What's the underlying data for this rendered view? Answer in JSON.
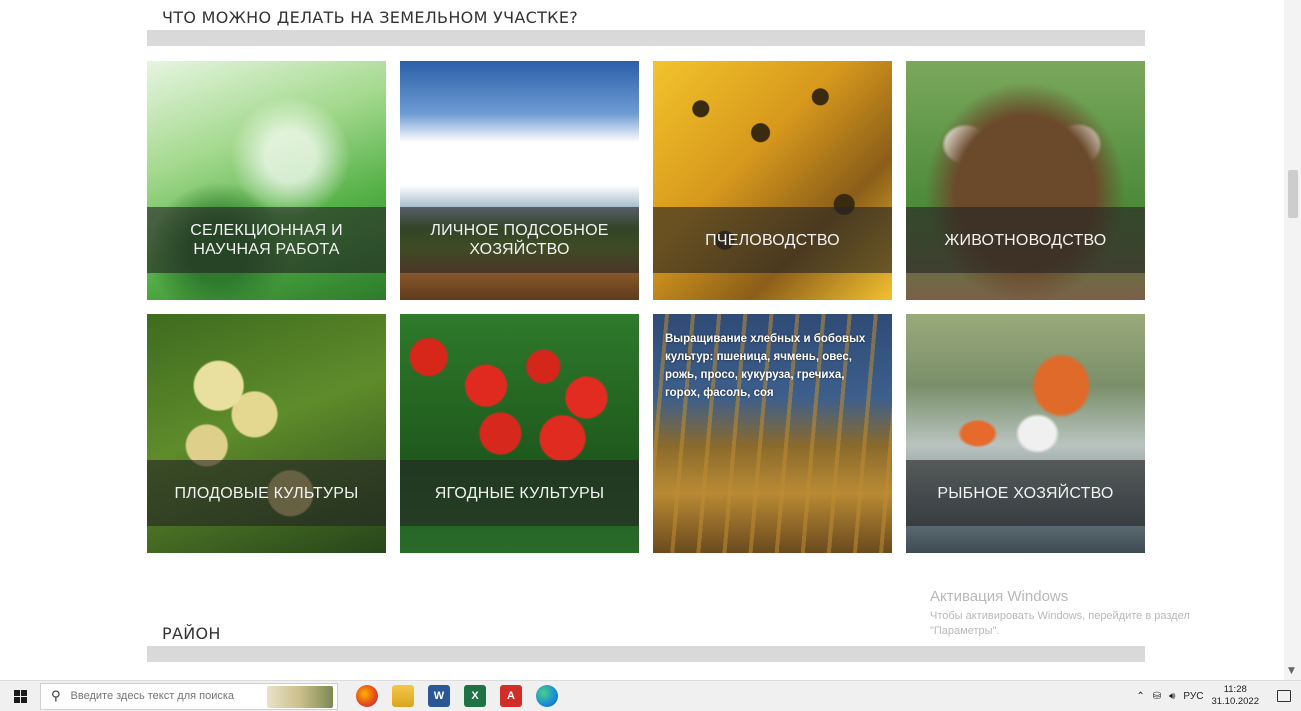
{
  "section1": {
    "title": "ЧТО МОЖНО ДЕЛАТЬ НА ЗЕМЕЛЬНОМ УЧАСТКЕ?"
  },
  "tiles": [
    {
      "label": "СЕЛЕКЦИОННАЯ И НАУЧНАЯ РАБОТА"
    },
    {
      "label": "ЛИЧНОЕ ПОДСОБНОЕ ХОЗЯЙСТВО"
    },
    {
      "label": "ПЧЕЛОВОДСТВО"
    },
    {
      "label": "ЖИВОТНОВОДСТВО"
    },
    {
      "label": "ПЛОДОВЫЕ КУЛЬТУРЫ"
    },
    {
      "label": "ЯГОДНЫЕ КУЛЬТУРЫ"
    },
    {
      "description": "Выращивание хлебных и бобовых культур: пшеница, ячмень, овес, рожь, просо, кукуруза, гречиха, горох, фасоль, соя"
    },
    {
      "label": "РЫБНОЕ ХОЗЯЙСТВО"
    }
  ],
  "section2": {
    "title": "РАЙОН"
  },
  "activation": {
    "title": "Активация Windows",
    "subtitle": "Чтобы активировать Windows, перейдите в раздел \"Параметры\"."
  },
  "taskbar": {
    "search_placeholder": "Введите здесь текст для поиска",
    "language": "РУС",
    "time": "11:28",
    "date": "31.10.2022",
    "icons": [
      "windows-icon",
      "search-icon",
      "firefox-icon",
      "file-explorer-icon",
      "word-icon",
      "excel-icon",
      "acrobat-icon",
      "edge-icon",
      "chevron-up-icon",
      "network-icon",
      "volume-icon",
      "notification-icon"
    ]
  }
}
